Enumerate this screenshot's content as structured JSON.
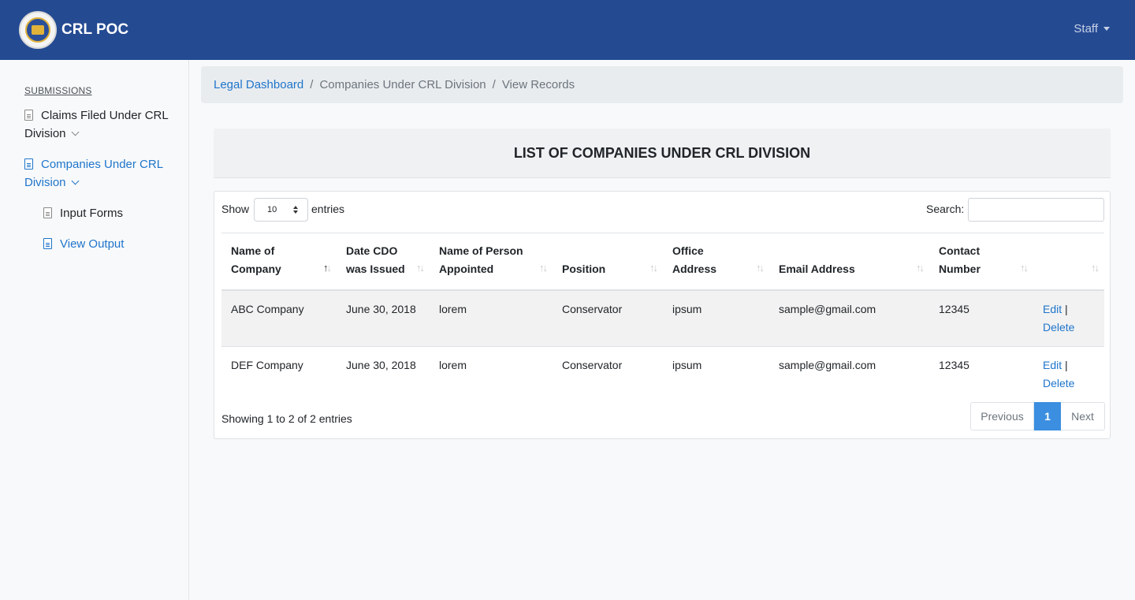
{
  "navbar": {
    "brand": "CRL POC",
    "user_menu": "Staff"
  },
  "sidebar": {
    "heading": "SUBMISSIONS",
    "items": [
      {
        "line1": "Claims Filed Under CRL",
        "line2": "Division"
      },
      {
        "line1": "Companies Under CRL",
        "line2": "Division"
      },
      {
        "label": "Input Forms"
      },
      {
        "label": "View Output"
      }
    ]
  },
  "breadcrumb": {
    "home": "Legal Dashboard",
    "section": "Companies Under CRL Division",
    "current": "View Records",
    "separator": "/"
  },
  "card": {
    "title": "LIST OF COMPANIES UNDER CRL DIVISION"
  },
  "table_controls": {
    "show_label": "Show",
    "entries_value": "10",
    "entries_label": "entries",
    "search_label": "Search:",
    "search_value": ""
  },
  "table": {
    "columns": [
      {
        "line1": "Name of",
        "line2": "Company"
      },
      {
        "line1": "Date CDO",
        "line2": "was Issued"
      },
      {
        "line1": "Name of Person",
        "line2": "Appointed"
      },
      {
        "line1": "",
        "line2": "Position"
      },
      {
        "line1": "Office",
        "line2": "Address"
      },
      {
        "line1": "",
        "line2": "Email Address"
      },
      {
        "line1": "Contact",
        "line2": "Number"
      },
      {
        "line1": "",
        "line2": ""
      }
    ],
    "rows": [
      {
        "company": "ABC Company",
        "date": "June 30, 2018",
        "person": "lorem",
        "position": "Conservator",
        "office": "ipsum",
        "email": "sample@gmail.com",
        "contact": "12345",
        "edit": "Edit",
        "pipe": "|",
        "delete": "Delete"
      },
      {
        "company": "DEF Company",
        "date": "June 30, 2018",
        "person": "lorem",
        "position": "Conservator",
        "office": "ipsum",
        "email": "sample@gmail.com",
        "contact": "12345",
        "edit": "Edit",
        "pipe": "|",
        "delete": "Delete"
      }
    ]
  },
  "footer": {
    "showing": "Showing 1 to 2 of 2 entries",
    "previous": "Previous",
    "current_page": "1",
    "next": "Next"
  },
  "colors": {
    "navbar_bg": "#244a92",
    "link": "#1f75cb",
    "active_page": "#3b8ee0"
  }
}
